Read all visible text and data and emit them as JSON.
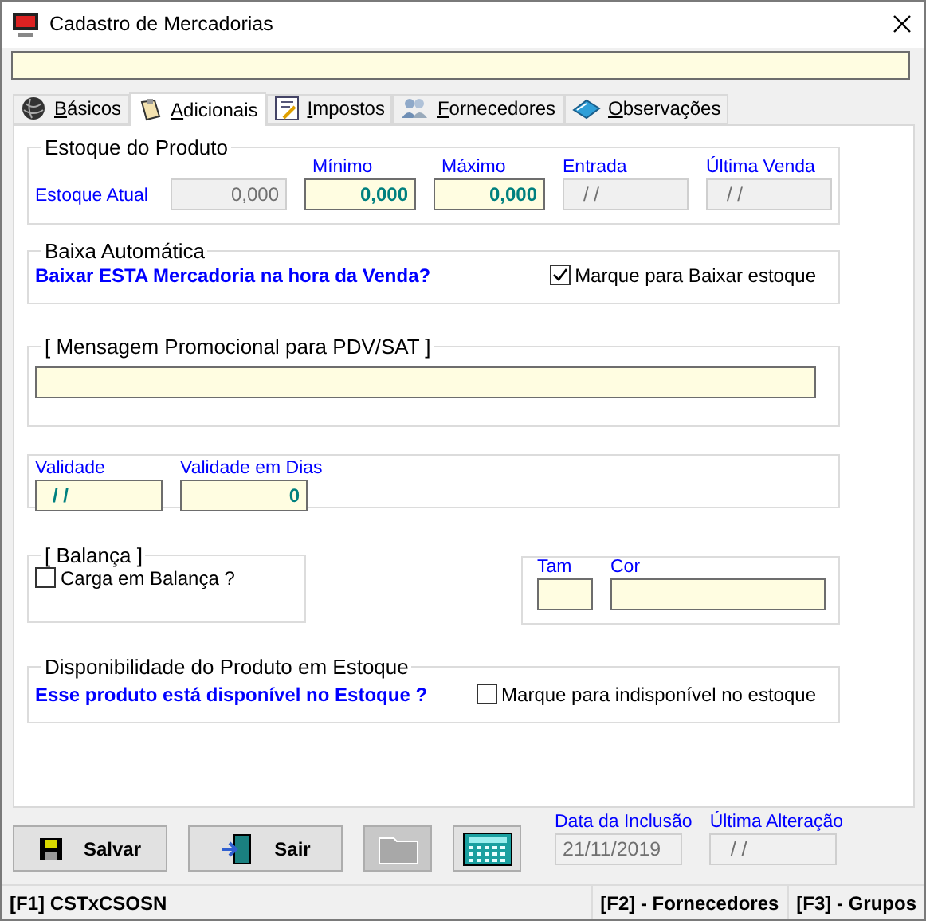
{
  "window": {
    "title": "Cadastro de Mercadorias"
  },
  "tabs": [
    {
      "label": "Básicos",
      "kind": "yarn",
      "selected": false
    },
    {
      "label": "Adicionais",
      "kind": "clipboard",
      "selected": true
    },
    {
      "label": "Impostos",
      "kind": "form",
      "selected": false
    },
    {
      "label": "Fornecedores",
      "kind": "people",
      "selected": false
    },
    {
      "label": "Observações",
      "kind": "book",
      "selected": false
    }
  ],
  "estoque": {
    "title": "Estoque do Produto",
    "current": {
      "label": "Estoque Atual",
      "value": "0,000"
    },
    "fields": [
      {
        "label": "Mínimo",
        "value": "0,000",
        "kind": "editable"
      },
      {
        "label": "Máximo",
        "value": "0,000",
        "kind": "editable"
      },
      {
        "label": "Entrada",
        "value": "/ /",
        "kind": "readonly"
      },
      {
        "label": "Última Venda",
        "value": "/ /",
        "kind": "readonly"
      }
    ]
  },
  "baixa": {
    "title": "Baixa Automática",
    "question": "Baixar ESTA Mercadoria na hora da Venda?",
    "checkbox": {
      "label": "Marque para Baixar estoque",
      "checked": true
    }
  },
  "mensagem": {
    "title": "[ Mensagem Promocional para PDV/SAT ]"
  },
  "validade": {
    "fields": [
      {
        "label": "Validade",
        "value": "/ /",
        "kind": "date"
      },
      {
        "label": "Validade em Dias",
        "value": "0",
        "kind": "number"
      }
    ]
  },
  "balanca": {
    "title": "[ Balança ]",
    "checkbox": {
      "label": "Carga em Balança ?",
      "checked": false
    }
  },
  "tam_cor": {
    "fields": [
      {
        "label": "Tam"
      },
      {
        "label": "Cor"
      }
    ]
  },
  "disponibilidade": {
    "title": "Disponibilidade do Produto em Estoque",
    "question": "Esse produto está disponível no Estoque ?",
    "checkbox": {
      "label": "Marque para indisponível no estoque",
      "checked": false
    }
  },
  "buttons": [
    {
      "kind": "save",
      "label": "Salvar",
      "disabled": false
    },
    {
      "kind": "exit",
      "label": "Sair",
      "disabled": false
    },
    {
      "kind": "folder",
      "disabled": true
    },
    {
      "kind": "calculator",
      "disabled": false
    }
  ],
  "dates": [
    {
      "label": "Data da Inclusão",
      "value": "21/11/2019"
    },
    {
      "label": "Última Alteração",
      "value": "/ /"
    }
  ],
  "status_bar": [
    "[F1] CSTxCSOSN",
    "[F2] - Fornecedores",
    "[F3] - Grupos"
  ]
}
